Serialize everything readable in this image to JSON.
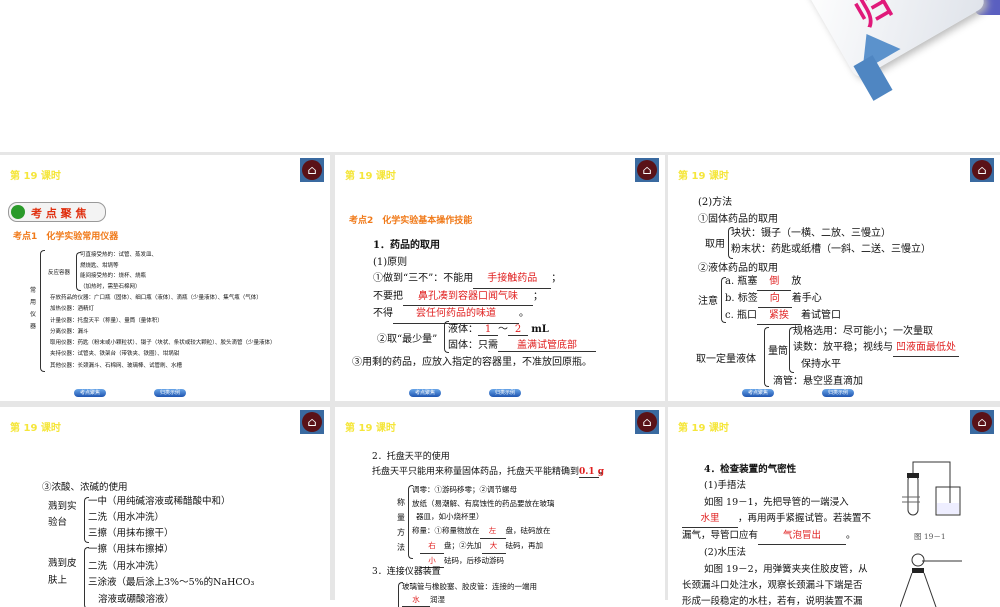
{
  "header": {
    "key_char": "归"
  },
  "lesson": "第 19 课时",
  "nav": {
    "prev": "考点聚焦",
    "next": "归类示例"
  },
  "s1": {
    "badge": "考 点 聚 焦",
    "title": "考点1　化学实验常用仪器",
    "root": "常用仪器",
    "rx": "反应容器",
    "rx_items": [
      "可直接受热的：试管、蒸发皿、",
      "燃烧匙、坩埚等",
      "能间接受热的：烧杯、烧瓶",
      "（加热时，需垫石棉网）"
    ],
    "items": [
      "存放药品的仪器：广口瓶（固体）、细口瓶（液体）、滴瓶（少量液体）、集气瓶（气体）",
      "加热仪器：酒精灯",
      "计量仪器：托盘天平（称量）、量筒（量体积）",
      "分离仪器：漏斗",
      "取用仪器：药匙（粉末或小颗粒状）、镊子（块状、条状或较大颗粒）、胶头滴管（少量液体）",
      "夹持仪器：试管夹、铁架台（带铁夹、铁圈）、坩埚钳",
      "其他仪器：长颈漏斗、石棉网、玻璃棒、试管刷、水槽"
    ]
  },
  "s2": {
    "title": "考点2　化学实验基本操作技能",
    "h1": "1．药品的取用",
    "h2": "(1)原则",
    "l1a": "①做到“三不”：不能用",
    "l1b": "手接触药品",
    "l1c": "；",
    "l2a": "不要把",
    "l2b": "鼻孔凑到容器口闻气味",
    "l2c": "；",
    "l3a": "不得",
    "l3b": "尝任何药品的味道",
    "l3c": "。",
    "least": "②取“最少量”",
    "liq": "液体：",
    "v1": "1",
    "tilde": "～",
    "v2": "2",
    "ml": "mL",
    "sol": "固体：只需",
    "solv": "盖满试管底部",
    "l4": "③用剩的药品，应放入指定的容器里，不准放回原瓶。"
  },
  "s3": {
    "h": "(2)方法",
    "a": "①固体药品的取用",
    "take": "取用",
    "t1": "块状：镊子（一横、二放、三慢立）",
    "t2": "粉末状：药匙或纸槽（一斜、二送、三慢立）",
    "b": "②液体药品的取用",
    "note": "注意",
    "n1a": "a. 瓶塞",
    "n1b": "倒",
    "n1c": "放",
    "n2a": "b. 标签",
    "n2b": "向",
    "n2c": "着手心",
    "n3a": "c. 瓶口",
    "n3b": "紧挨",
    "n3c": "着试管口",
    "q": "取一定量液体",
    "cyl": "量筒",
    "c1": "规格选用：尽可能小；一次量取",
    "c2a": "读数：放平稳；视线与",
    "c2b": "凹液面最低处",
    "c3": "保持水平",
    "drop": "滴管：悬空竖直滴加"
  },
  "s4": {
    "h": "③浓酸、浓碱的使用",
    "g1": "溅到实验台",
    "g1i": [
      "一中（用纯碱溶液或稀醋酸中和）",
      "二洗（用水冲洗）",
      "三擦（用抹布擦干）"
    ],
    "g2": "溅到皮肤上",
    "g2i": [
      "一擦（用抹布擦掉）",
      "二洗（用水冲洗）",
      "三涂液（最后涂上3%～5%的NaHCO₃",
      "溶液或硼酸溶液）"
    ]
  },
  "s5": {
    "h": "2．托盘天平的使用",
    "p1": "托盘天平只能用来称量固体药品，托盘天平能精确到",
    "p1v": "0.1 g",
    "p1e": "。",
    "m": "称量方法",
    "m1": "调零：①游码移零；②调节螺母",
    "m2": "放纸（易潮解、有腐蚀性的药品要放在玻璃",
    "m3": "器皿，如小烧杯里）",
    "m4a": "称量：①称量物放在",
    "m4b": "左",
    "m4c": "盘，砝码放在",
    "m5b": "右",
    "m5c": "盘；②先加",
    "m5d": "大",
    "m5e": "砝码，再加",
    "m6b": "小",
    "m6c": "砝码，后移动游码",
    "h3": "3．连接仪器装置",
    "c1": "玻璃管与橡胶塞、胶皮管：连接的一端用",
    "c2b": "水",
    "c2c": "润湿"
  },
  "s6": {
    "h": "4．检查装置的气密性",
    "h1": "(1)手捂法",
    "p1": "如图 19－1，先把导管的一端浸入",
    "p2b": "水里",
    "p2c": "，再用两手紧握试管。若装置不",
    "p3a": "漏气，导管口应有",
    "p3b": "气泡冒出",
    "p3c": "。",
    "h2": "(2)水压法",
    "p4": "如图 19－2，用弹簧夹夹住胶皮管，从",
    "p5": "长颈漏斗口处注水，观察长颈漏斗下端是否",
    "p6": "形成一段稳定的水柱，若有，说明装置不漏",
    "fig1": "图 19－1"
  }
}
